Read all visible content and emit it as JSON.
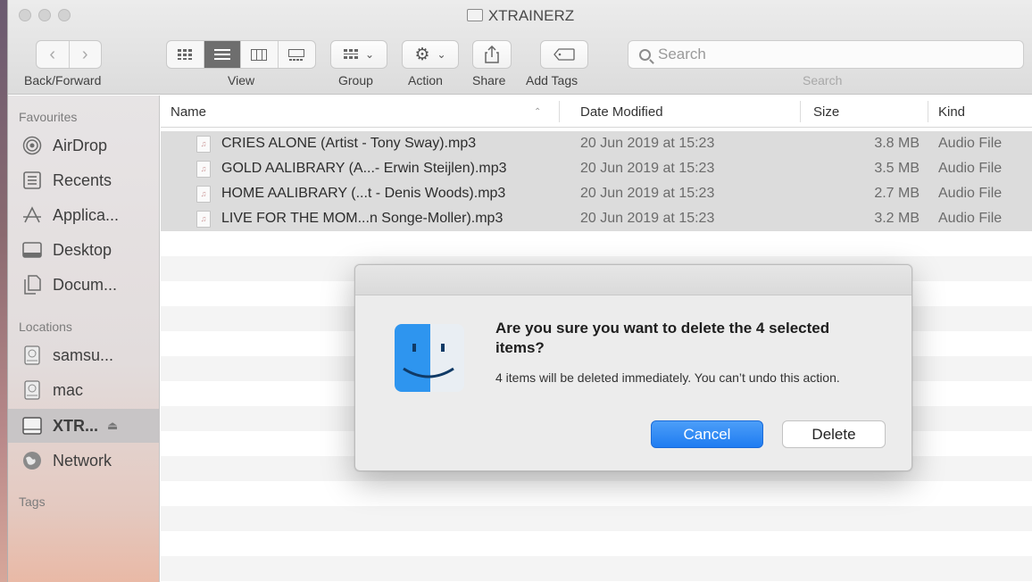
{
  "window": {
    "title": "XTRAINERZ"
  },
  "toolbar": {
    "back_label": "Back/Forward",
    "view_label": "View",
    "group_label": "Group",
    "action_label": "Action",
    "share_label": "Share",
    "add_tags_label": "Add Tags",
    "search_label": "Search",
    "search_placeholder": "Search"
  },
  "sidebar": {
    "favourites_heading": "Favourites",
    "favourites": [
      {
        "label": "AirDrop",
        "icon": "airdrop-icon"
      },
      {
        "label": "Recents",
        "icon": "recents-icon"
      },
      {
        "label": "Applica...",
        "icon": "applications-icon"
      },
      {
        "label": "Desktop",
        "icon": "desktop-icon"
      },
      {
        "label": "Docum...",
        "icon": "documents-icon"
      }
    ],
    "locations_heading": "Locations",
    "locations": [
      {
        "label": "samsu...",
        "icon": "disk-icon"
      },
      {
        "label": "mac",
        "icon": "disk-icon"
      },
      {
        "label": "XTR...",
        "icon": "drive-icon",
        "selected": true
      },
      {
        "label": "Network",
        "icon": "network-icon"
      }
    ],
    "tags_heading": "Tags"
  },
  "columns": {
    "name": "Name",
    "date": "Date Modified",
    "size": "Size",
    "kind": "Kind"
  },
  "files": [
    {
      "name": "CRIES ALONE (Artist - Tony Sway).mp3",
      "date": "20 Jun 2019 at 15:23",
      "size": "3.8 MB",
      "kind": "Audio File"
    },
    {
      "name": "GOLD AALIBRARY (A...- Erwin Steijlen).mp3",
      "date": "20 Jun 2019 at 15:23",
      "size": "3.5 MB",
      "kind": "Audio File"
    },
    {
      "name": "HOME AALIBRARY (...t - Denis Woods).mp3",
      "date": "20 Jun 2019 at 15:23",
      "size": "2.7 MB",
      "kind": "Audio File"
    },
    {
      "name": "LIVE FOR THE MOM...n Songe-Moller).mp3",
      "date": "20 Jun 2019 at 15:23",
      "size": "3.2 MB",
      "kind": "Audio File"
    }
  ],
  "dialog": {
    "title": "Are you sure you want to delete the 4 selected items?",
    "message": "4 items will be deleted immediately. You can’t undo this action.",
    "cancel_label": "Cancel",
    "delete_label": "Delete"
  },
  "colors": {
    "accent": "#1f7cf1",
    "selection": "#dcdcdc",
    "sidebar_selected": "#c8c5c6"
  }
}
